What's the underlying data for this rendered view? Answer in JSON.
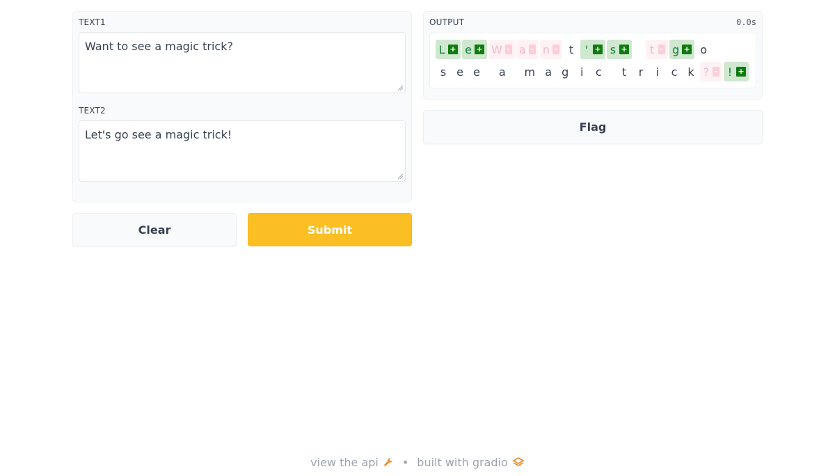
{
  "inputs": {
    "text1": {
      "label": "TEXT1",
      "value": "Want to see a magic trick?"
    },
    "text2": {
      "label": "TEXT2",
      "value": "Let's go see a magic trick!"
    }
  },
  "buttons": {
    "clear": "Clear",
    "submit": "Submit",
    "flag": "Flag"
  },
  "output": {
    "label": "OUTPUT",
    "timer": "0.0s",
    "diff_lines": [
      [
        {
          "ch": "L",
          "op": "add"
        },
        {
          "ch": "e",
          "op": "add"
        },
        {
          "ch": "W",
          "op": "del"
        },
        {
          "ch": "a",
          "op": "del"
        },
        {
          "ch": "n",
          "op": "del"
        },
        {
          "ch": "t",
          "op": "eq"
        },
        {
          "ch": "'",
          "op": "add"
        },
        {
          "ch": "s",
          "op": "add"
        },
        {
          "ch": " ",
          "op": "eq"
        },
        {
          "ch": "t",
          "op": "del"
        },
        {
          "ch": "g",
          "op": "add"
        },
        {
          "ch": "o",
          "op": "eq"
        }
      ],
      [
        {
          "ch": "s",
          "op": "eq"
        },
        {
          "ch": "e",
          "op": "eq"
        },
        {
          "ch": "e",
          "op": "eq"
        },
        {
          "ch": " ",
          "op": "eq"
        },
        {
          "ch": "a",
          "op": "eq"
        },
        {
          "ch": " ",
          "op": "eq"
        },
        {
          "ch": "m",
          "op": "eq"
        },
        {
          "ch": "a",
          "op": "eq"
        },
        {
          "ch": "g",
          "op": "eq"
        },
        {
          "ch": "i",
          "op": "eq"
        },
        {
          "ch": "c",
          "op": "eq"
        },
        {
          "ch": " ",
          "op": "eq"
        },
        {
          "ch": "t",
          "op": "eq"
        },
        {
          "ch": "r",
          "op": "eq"
        },
        {
          "ch": "i",
          "op": "eq"
        },
        {
          "ch": "c",
          "op": "eq"
        },
        {
          "ch": "k",
          "op": "eq"
        },
        {
          "ch": "?",
          "op": "del"
        },
        {
          "ch": "!",
          "op": "add"
        }
      ]
    ],
    "badges": {
      "add": "+",
      "del": "-"
    }
  },
  "footer": {
    "api_link": "view the api",
    "separator": "•",
    "built_with": "built with gradio"
  },
  "colors": {
    "accent": "#fbbf24",
    "add_bg": "#cfe8cf",
    "add_badge": "#0f7a0f",
    "del_bg": "#fef2f4",
    "del_text": "#f7b8c5"
  },
  "icons": {
    "api": "wrench-icon",
    "gradio": "gradio-logo-icon"
  }
}
